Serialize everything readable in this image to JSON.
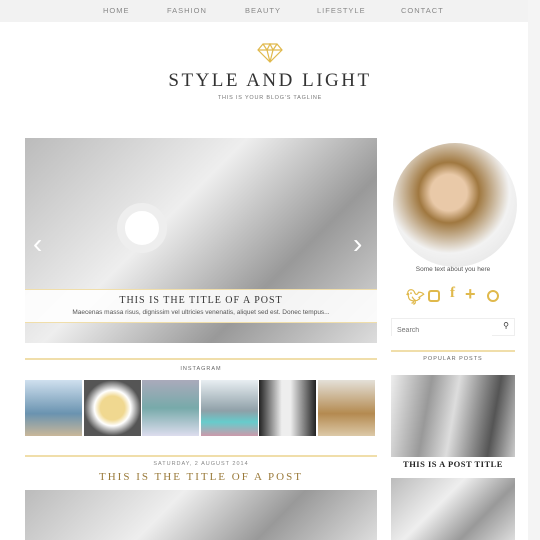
{
  "nav": {
    "items": [
      "HOME",
      "FASHION",
      "BEAUTY",
      "LIFESTYLE",
      "CONTACT"
    ]
  },
  "header": {
    "title": "STYLE AND LIGHT",
    "tagline": "THIS IS YOUR BLOG'S TAGLINE",
    "logo": "diamond-icon"
  },
  "slider": {
    "title": "THIS IS THE TITLE OF A POST",
    "excerpt": "Maecenas massa risus, dignissim vel ultricies venenatis, aliquet sed est. Donec tempus...",
    "prev": "‹",
    "next": "›"
  },
  "instagram": {
    "heading": "INSTAGRAM",
    "images": 6
  },
  "post": {
    "date": "SATURDAY, 2 AUGUST 2014",
    "title": "THIS IS THE TITLE OF A POST"
  },
  "sidebar": {
    "about": "Some text about you here",
    "social": [
      "twitter-icon",
      "instagram-icon",
      "facebook-icon",
      "plus-icon",
      "pinterest-icon"
    ],
    "search_placeholder": "Search",
    "popular_heading": "POPULAR POSTS",
    "popular_title": "THIS IS A POST TITLE"
  },
  "colors": {
    "accent": "#e0b94c",
    "nav_bg": "#f2f2f2"
  }
}
